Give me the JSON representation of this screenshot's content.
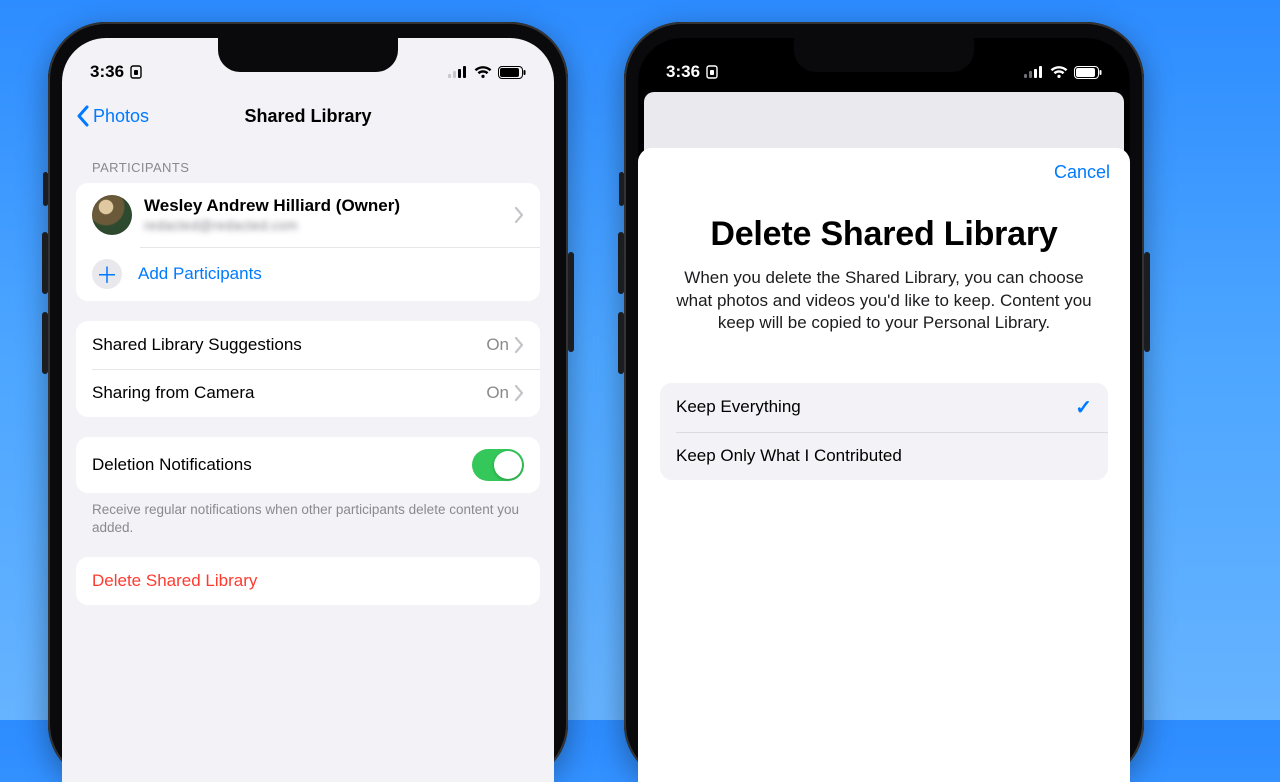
{
  "statusbar": {
    "time": "3:36"
  },
  "left": {
    "nav": {
      "back_label": "Photos",
      "title": "Shared Library"
    },
    "participants": {
      "header": "Participants",
      "owner_name": "Wesley Andrew Hilliard (Owner)",
      "owner_sub": "redacted@redacted.com",
      "add_label": "Add Participants"
    },
    "settings": {
      "suggestions_label": "Shared Library Suggestions",
      "suggestions_value": "On",
      "camera_label": "Sharing from Camera",
      "camera_value": "On"
    },
    "notifications": {
      "label": "Deletion Notifications",
      "on": true,
      "footer": "Receive regular notifications when other participants delete content you added."
    },
    "delete_label": "Delete Shared Library"
  },
  "right": {
    "cancel": "Cancel",
    "title": "Delete Shared Library",
    "desc": "When you delete the Shared Library, you can choose what photos and videos you'd like to keep. Content you keep will be copied to your Personal Library.",
    "options": {
      "keep_all": "Keep Everything",
      "keep_mine": "Keep Only What I Contributed",
      "selected": "keep_all"
    }
  }
}
